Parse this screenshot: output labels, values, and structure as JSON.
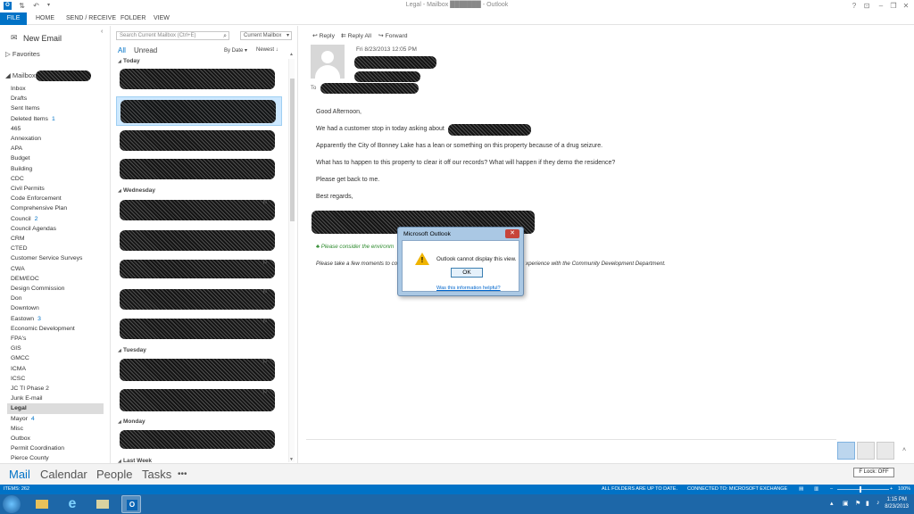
{
  "window": {
    "title": "Legal - Mailbox ███████ - Outlook"
  },
  "ribbon": {
    "tabs": [
      "FILE",
      "HOME",
      "SEND / RECEIVE",
      "FOLDER",
      "VIEW"
    ]
  },
  "folder_pane": {
    "new_email": "New Email",
    "favorites": "Favorites",
    "mailbox": "Mailbox",
    "folders": [
      {
        "name": "Inbox"
      },
      {
        "name": "Drafts"
      },
      {
        "name": "Sent Items"
      },
      {
        "name": "Deleted Items",
        "count": "1"
      },
      {
        "name": "465"
      },
      {
        "name": "Annexation"
      },
      {
        "name": "APA"
      },
      {
        "name": "Budget"
      },
      {
        "name": "Building"
      },
      {
        "name": "CDC"
      },
      {
        "name": "Civil Permits"
      },
      {
        "name": "Code Enforcement"
      },
      {
        "name": "Comprehensive Plan"
      },
      {
        "name": "Council",
        "count": "2"
      },
      {
        "name": "Council Agendas"
      },
      {
        "name": "CRM"
      },
      {
        "name": "CTED"
      },
      {
        "name": "Customer Service Surveys"
      },
      {
        "name": "CWA"
      },
      {
        "name": "DEM/EOC"
      },
      {
        "name": "Design Commission"
      },
      {
        "name": "Don"
      },
      {
        "name": "Downtown"
      },
      {
        "name": "Eastown",
        "count": "3"
      },
      {
        "name": "Economic Development"
      },
      {
        "name": "FPA's"
      },
      {
        "name": "GIS"
      },
      {
        "name": "GMCC"
      },
      {
        "name": "ICMA"
      },
      {
        "name": "ICSC"
      },
      {
        "name": "JC TI Phase 2"
      },
      {
        "name": "Junk E-mail"
      },
      {
        "name": "Legal",
        "selected": true
      },
      {
        "name": "Mayor",
        "count": "4"
      },
      {
        "name": "Misc"
      },
      {
        "name": "Outbox"
      },
      {
        "name": "Permit Coordination"
      },
      {
        "name": "Pierce County"
      }
    ]
  },
  "message_list": {
    "search_placeholder": "Search Current Mailbox (Ctrl+E)",
    "scope": "Current Mailbox",
    "filter_all": "All",
    "filter_unread": "Unread",
    "sort_by": "By Date",
    "sort_order": "Newest",
    "groups": [
      "Today",
      "Wednesday",
      "Tuesday",
      "Monday",
      "Last Week"
    ]
  },
  "reading_pane": {
    "actions": {
      "reply": "Reply",
      "reply_all": "Reply All",
      "forward": "Forward"
    },
    "date": "Fri 8/23/2013 12:05 PM",
    "to_label": "To",
    "body": {
      "greeting": "Good Afternoon,",
      "line1": "We had a customer stop in today asking about",
      "line2": "Apparently the City of Bonney Lake has a lean or something on this property because of a drug seizure.",
      "line3": "What has to happen to this property to clear it off our records? What will happen if they demo the residence?",
      "line4": "Please get back to me.",
      "signoff": "Best regards,",
      "green_note": "Please consider the environm",
      "survey_start": "Please take a few moments to co",
      "survey_end": "xperience with the Community Development Department."
    }
  },
  "dialog": {
    "title": "Microsoft Outlook",
    "close": "✕",
    "message": "Outlook cannot display this view.",
    "ok": "OK",
    "help": "Was this information helpful?"
  },
  "navbar": {
    "mail": "Mail",
    "calendar": "Calendar",
    "people": "People",
    "tasks": "Tasks",
    "more": "•••",
    "f_lock": "F Lock: OFF"
  },
  "status": {
    "items": "ITEMS: 262",
    "sync": "ALL FOLDERS ARE UP TO DATE.",
    "connection": "CONNECTED TO: MICROSOFT EXCHANGE",
    "zoom": "100%"
  },
  "taskbar": {
    "time": "1:15 PM",
    "date": "8/23/2013"
  }
}
